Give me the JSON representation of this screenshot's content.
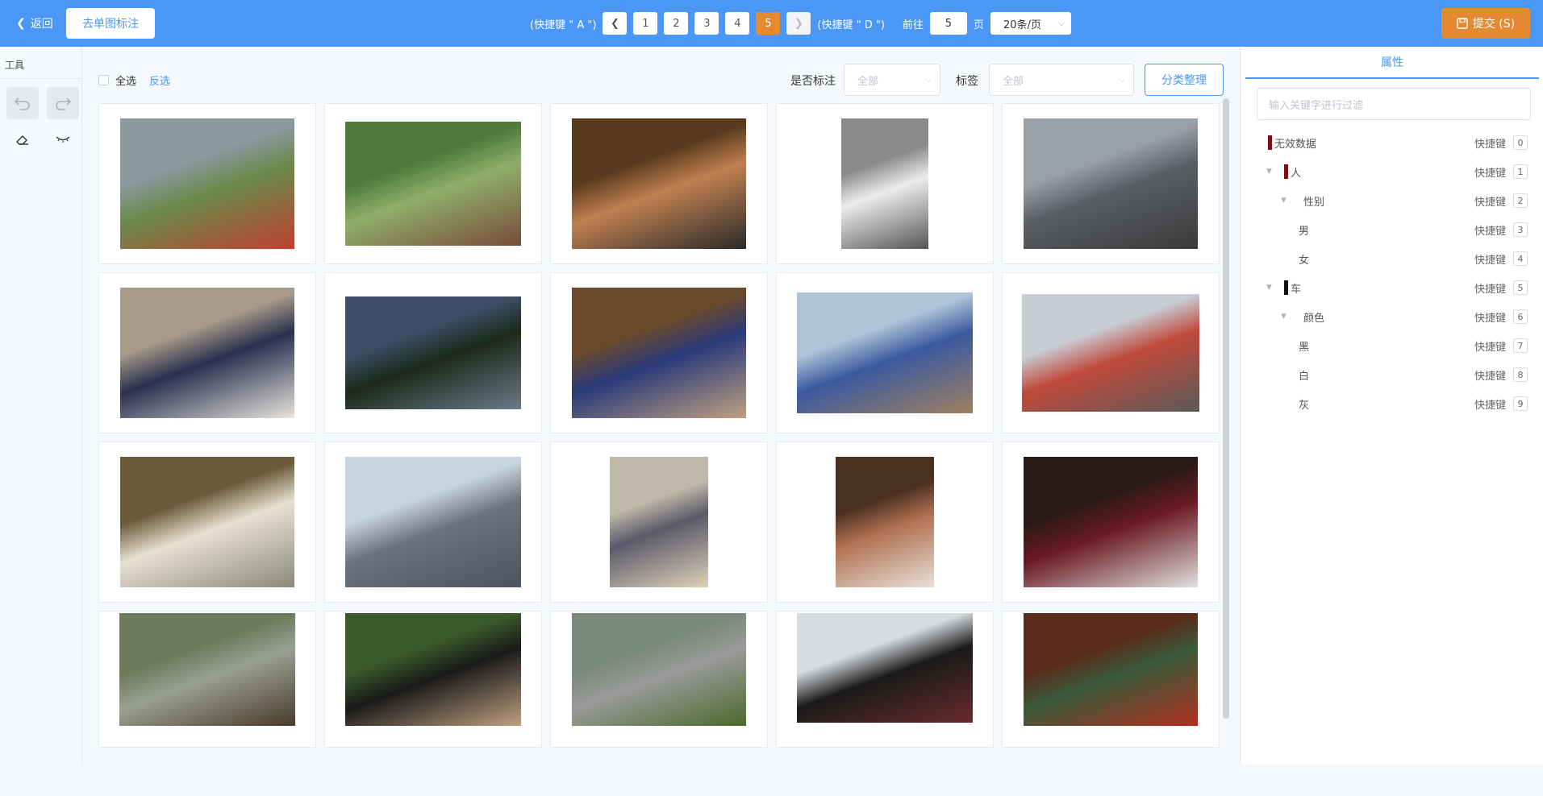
{
  "header": {
    "back_label": "返回",
    "single_label": "去单图标注",
    "prev_hint": "(快捷键 \" A \")",
    "next_hint": "(快捷键 \" D \")",
    "pages": [
      "1",
      "2",
      "3",
      "4",
      "5"
    ],
    "current_page": "5",
    "goto_label": "前往",
    "goto_value": "5",
    "page_unit": "页",
    "page_size": "20条/页",
    "submit_label": "提交 (S)",
    "accent_color": "#4a97f7",
    "submit_color": "#e58a31"
  },
  "tools": {
    "title": "工具"
  },
  "filter": {
    "select_all": "全选",
    "invert": "反选",
    "annotated_label": "是否标注",
    "annotated_value": "全部",
    "tag_label": "标签",
    "tag_value": "全部",
    "classify_label": "分类整理"
  },
  "photos": [
    "motorcycle rider on track",
    "woman with cat in plants",
    "woman smiling indoors",
    "man with white horse",
    "motorcycles on road",
    "living room with sofas",
    "moon over landscape",
    "woman in kitchen",
    "cowboy on horse",
    "red and white train",
    "sheep behind fence",
    "navy warships",
    "child in white hat",
    "person cutting food",
    "dinner table",
    "bicycle by tree",
    "family on motorcycle",
    "people walking dogs",
    "steam locomotive",
    "room with christmas tree"
  ],
  "attributes": {
    "tab_label": "属性",
    "search_placeholder": "输入关键字进行过滤",
    "shortcut_label": "快捷键",
    "items": [
      {
        "label": "无效数据",
        "key": "0",
        "color": "#7a0f14"
      },
      {
        "label": "人",
        "key": "1",
        "color": "#7a0f14"
      },
      {
        "label": "性别",
        "key": "2",
        "color": ""
      },
      {
        "label": "男",
        "key": "3",
        "color": ""
      },
      {
        "label": "女",
        "key": "4",
        "color": ""
      },
      {
        "label": "车",
        "key": "5",
        "color": "#111111"
      },
      {
        "label": "颜色",
        "key": "6",
        "color": ""
      },
      {
        "label": "黑",
        "key": "7",
        "color": ""
      },
      {
        "label": "白",
        "key": "8",
        "color": ""
      },
      {
        "label": "灰",
        "key": "9",
        "color": ""
      }
    ]
  }
}
